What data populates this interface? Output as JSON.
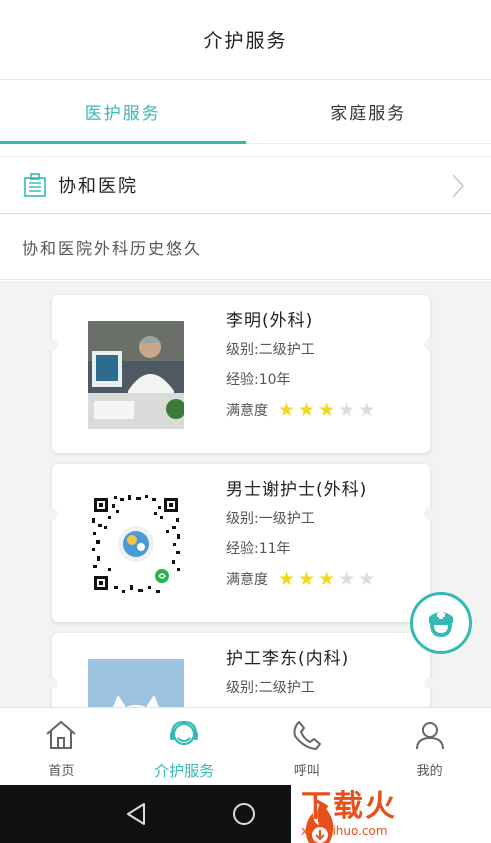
{
  "header": {
    "title": "介护服务"
  },
  "tabs": [
    {
      "label": "医护服务",
      "active": true
    },
    {
      "label": "家庭服务",
      "active": false
    }
  ],
  "hospital": {
    "name": "协和医院",
    "icon": "hospital-icon"
  },
  "description": "协和医院外科历史悠久",
  "caregivers": [
    {
      "name": "李明(外科)",
      "level": "级别:二级护工",
      "experience": "经验:10年",
      "rating_label": "满意度",
      "rating": 3,
      "rating_max": 5
    },
    {
      "name": "男士谢护士(外科)",
      "level": "级别:一级护工",
      "experience": "经验:11年",
      "rating_label": "满意度",
      "rating": 3,
      "rating_max": 5
    },
    {
      "name": "护工李东(内科)",
      "level": "级别:二级护工",
      "experience": "",
      "rating_label": "",
      "rating": 0,
      "rating_max": 5
    }
  ],
  "bottom_nav": [
    {
      "label": "首页",
      "icon": "home-icon",
      "active": false
    },
    {
      "label": "介护服务",
      "icon": "nurse-service-icon",
      "active": true
    },
    {
      "label": "呼叫",
      "icon": "phone-icon",
      "active": false
    },
    {
      "label": "我的",
      "icon": "user-icon",
      "active": false
    }
  ],
  "watermark": {
    "main": "下载火",
    "sub": "xiazaihuo.com"
  },
  "colors": {
    "accent": "#35b9b4",
    "star_on": "#f2d91a",
    "star_off": "#dcdcdc",
    "watermark": "#e8501b"
  }
}
